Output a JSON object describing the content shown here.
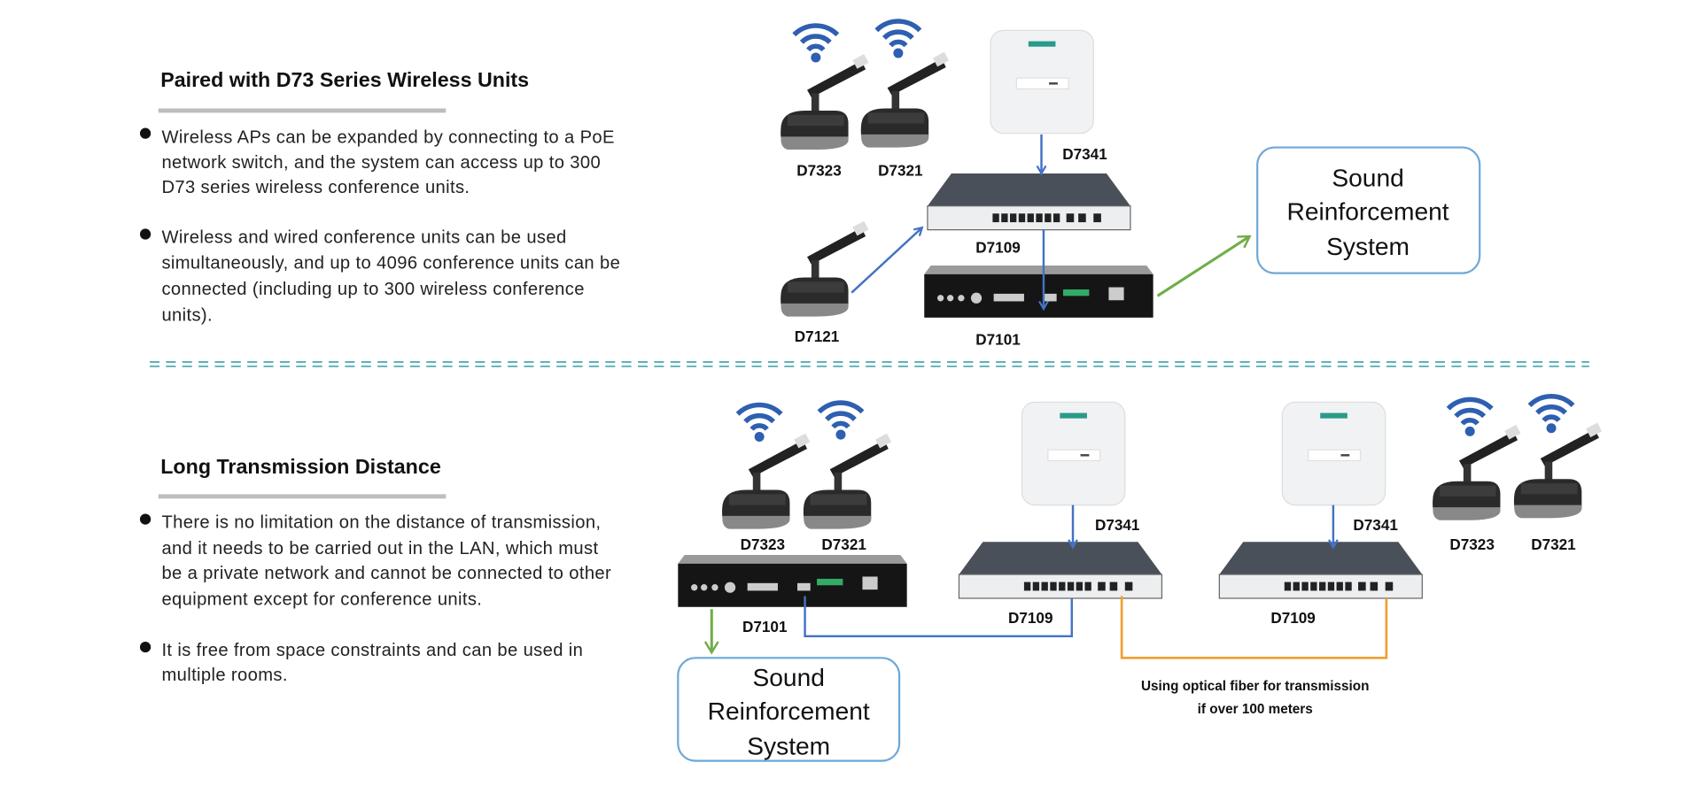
{
  "top": {
    "title": "Paired with D73 Series Wireless Units",
    "bullets": [
      [
        "Wireless APs can be expanded by connecting to a PoE",
        "network switch, and the system can access up to 300",
        "D73 series wireless conference units."
      ],
      [
        "Wireless and wired conference units can be used",
        "simultaneously, and up to 4096 conference units can be",
        "connected (including up to 300 wireless conference",
        "units)."
      ]
    ],
    "devices": {
      "d7323": "D7323",
      "d7321": "D7321",
      "d7341": "D7341",
      "d7109": "D7109",
      "d7121": "D7121",
      "d7101": "D7101"
    },
    "sound_box": [
      "Sound",
      "Reinforcement",
      "System"
    ]
  },
  "bottom": {
    "title": "Long Transmission Distance",
    "bullets": [
      [
        "There is no limitation on the distance of transmission,",
        "and it needs to be carried out in the LAN, which must",
        "be a private network and cannot be connected to other",
        "equipment except for conference units."
      ],
      [
        "It is free from space constraints and can be used in",
        "multiple rooms."
      ]
    ],
    "devices": {
      "d7323": "D7323",
      "d7321": "D7321",
      "d7341": "D7341",
      "d7109": "D7109",
      "d7101": "D7101"
    },
    "sound_box": [
      "Sound",
      "Reinforcement",
      "System"
    ],
    "fiber_caption": [
      "Using optical fiber for transmission",
      "if over 100 meters"
    ]
  },
  "colors": {
    "blue_line": "#4472c4",
    "green_line": "#70ad47",
    "orange_line": "#f0a030",
    "box_border": "#6fa8d6",
    "divider": "#5fb3b3",
    "wifi": "#2e5fb0"
  }
}
